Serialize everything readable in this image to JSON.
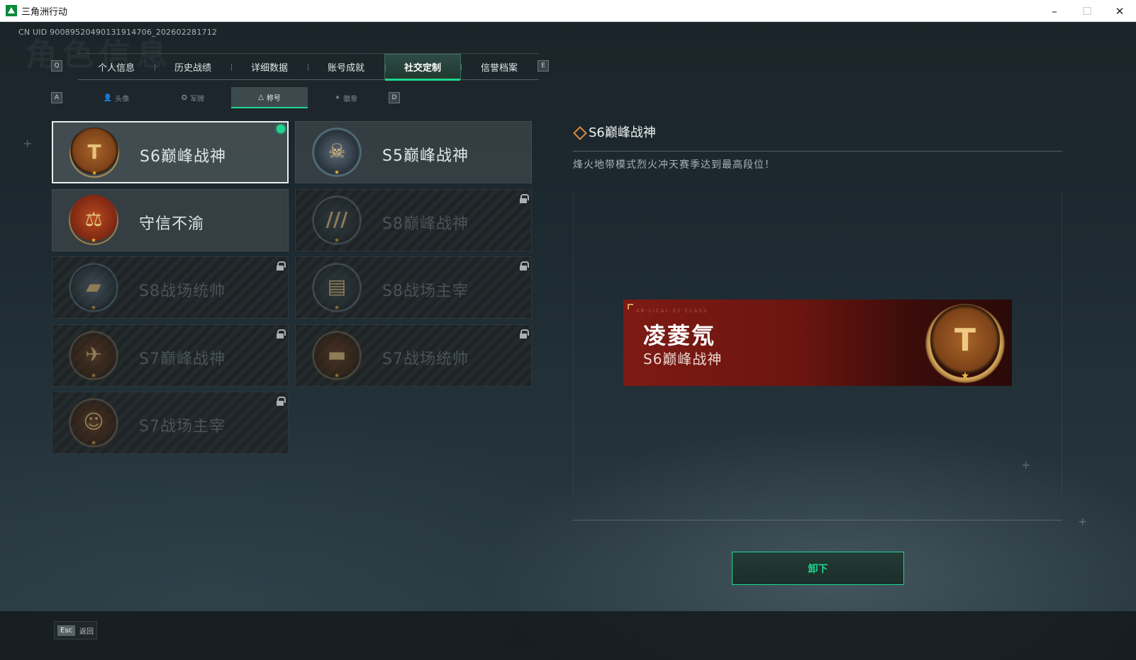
{
  "window": {
    "title": "三角洲行动",
    "minimize": "–",
    "maximize": "☐",
    "close": "✕"
  },
  "uid": "CN UID 9008952049013191470​6_202602281712",
  "page_bg_title": "角色信息",
  "keys": {
    "tab_prev": "Q",
    "tab_next": "E",
    "sub_prev": "A",
    "sub_next": "D"
  },
  "tabs": [
    "个人信息",
    "历史战绩",
    "详细数据",
    "账号成就",
    "社交定制",
    "信誉档案"
  ],
  "active_tab": 4,
  "subtabs": [
    {
      "icon": "person-icon",
      "glyph": "👤",
      "label": "头像"
    },
    {
      "icon": "insignia-icon",
      "glyph": "✪",
      "label": "军牌"
    },
    {
      "icon": "title-icon",
      "glyph": "△",
      "label": "称号"
    },
    {
      "icon": "emblem-icon",
      "glyph": "✦",
      "label": "徽章"
    }
  ],
  "titles": [
    {
      "label": "S6巅峰战神",
      "badge": "gold",
      "glyph": "T",
      "locked": false,
      "equipped": true
    },
    {
      "label": "S5巅峰战神",
      "badge": "blue",
      "glyph": "☠",
      "locked": false,
      "equipped": false
    },
    {
      "label": "守信不渝",
      "badge": "red",
      "glyph": "⚖",
      "locked": false,
      "equipped": false
    },
    {
      "label": "S8巅峰战神",
      "badge": "dark",
      "glyph": "///",
      "locked": true,
      "equipped": false
    },
    {
      "label": "S8战场统帅",
      "badge": "blue",
      "glyph": "▰",
      "locked": true,
      "equipped": false
    },
    {
      "label": "S8战场主宰",
      "badge": "dark",
      "glyph": "▤",
      "locked": true,
      "equipped": false
    },
    {
      "label": "S7巅峰战神",
      "badge": "copper",
      "glyph": "✈",
      "locked": true,
      "equipped": false
    },
    {
      "label": "S7战场统帅",
      "badge": "copper",
      "glyph": "▬",
      "locked": true,
      "equipped": false
    },
    {
      "label": "S7战场主宰",
      "badge": "copper",
      "glyph": "☺",
      "locked": true,
      "equipped": false
    }
  ],
  "detail": {
    "title": "S6巅峰战神",
    "description": "烽火地带模式烈火冲天赛季达到最高段位！"
  },
  "namecard": {
    "player_name": "凌菱氖",
    "title": "S6巅峰战神",
    "glyph": "T",
    "star": "★"
  },
  "unequip_label": "卸下",
  "footer": {
    "esc_key": "Esc",
    "esc_label": "返回"
  },
  "colors": {
    "accent": "#1ed68f",
    "gold": "#e8c27a",
    "namecard_red": "#7e1a14"
  }
}
